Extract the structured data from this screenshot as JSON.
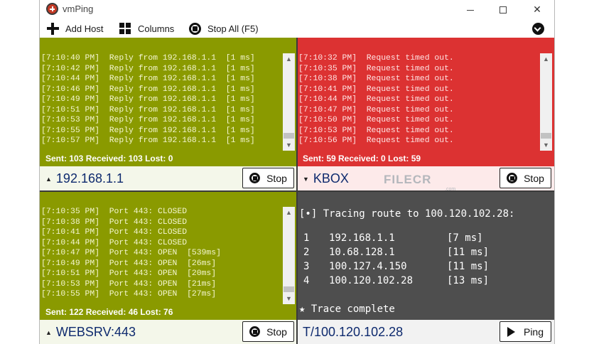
{
  "window": {
    "title": "vmPing"
  },
  "toolbar": {
    "add_host": "Add Host",
    "columns": "Columns",
    "stop_all": "Stop All (F5)"
  },
  "colors": {
    "up": "#8a9a00",
    "down": "#dc3232",
    "trace": "#4e4e4e",
    "footer_up": "#f4f7ea",
    "footer_down": "#fdeaea",
    "footer_trace": "#f2f2f2",
    "log_text_up": "#f4f6d0",
    "log_text_down": "#ffe4e4"
  },
  "probes": [
    {
      "host": "192.168.1.1",
      "stats": "Sent: 103 Received: 103 Lost: 0",
      "button": "Stop",
      "log": [
        "[7:10:40 PM]  Reply from 192.168.1.1  [1 ms]",
        "[7:10:42 PM]  Reply from 192.168.1.1  [1 ms]",
        "[7:10:44 PM]  Reply from 192.168.1.1  [1 ms]",
        "[7:10:46 PM]  Reply from 192.168.1.1  [1 ms]",
        "[7:10:49 PM]  Reply from 192.168.1.1  [1 ms]",
        "[7:10:51 PM]  Reply from 192.168.1.1  [1 ms]",
        "[7:10:53 PM]  Reply from 192.168.1.1  [1 ms]",
        "[7:10:55 PM]  Reply from 192.168.1.1  [1 ms]",
        "[7:10:57 PM]  Reply from 192.168.1.1  [1 ms]"
      ]
    },
    {
      "host": "KBOX",
      "stats": "Sent: 59 Received: 0 Lost: 59",
      "button": "Stop",
      "log": [
        "[7:10:32 PM]  Request timed out.",
        "[7:10:35 PM]  Request timed out.",
        "[7:10:38 PM]  Request timed out.",
        "[7:10:41 PM]  Request timed out.",
        "[7:10:44 PM]  Request timed out.",
        "[7:10:47 PM]  Request timed out.",
        "[7:10:50 PM]  Request timed out.",
        "[7:10:53 PM]  Request timed out.",
        "[7:10:56 PM]  Request timed out."
      ]
    },
    {
      "host": "WEBSRV:443",
      "stats": "Sent: 122 Received: 46 Lost: 76",
      "button": "Stop",
      "log": [
        "[7:10:35 PM]  Port 443: CLOSED",
        "[7:10:38 PM]  Port 443: CLOSED",
        "[7:10:41 PM]  Port 443: CLOSED",
        "[7:10:44 PM]  Port 443: CLOSED",
        "[7:10:47 PM]  Port 443: OPEN  [539ms]",
        "[7:10:49 PM]  Port 443: OPEN  [26ms]",
        "[7:10:51 PM]  Port 443: OPEN  [20ms]",
        "[7:10:53 PM]  Port 443: OPEN  [21ms]",
        "[7:10:55 PM]  Port 443: OPEN  [27ms]"
      ]
    },
    {
      "host": "T/100.120.102.28",
      "button": "Ping",
      "trace_header": "[•] Tracing route to 100.120.102.28:",
      "hops": [
        {
          "n": "1",
          "ip": "192.168.1.1",
          "ms": "[7 ms]"
        },
        {
          "n": "2",
          "ip": "10.68.128.1",
          "ms": "[11 ms]"
        },
        {
          "n": "3",
          "ip": "100.127.4.150",
          "ms": "[11 ms]"
        },
        {
          "n": "4",
          "ip": "100.120.102.28",
          "ms": "[13 ms]"
        }
      ],
      "trace_footer": "★ Trace complete"
    }
  ],
  "watermark": {
    "text": "FILECR",
    "sub": ".com"
  }
}
